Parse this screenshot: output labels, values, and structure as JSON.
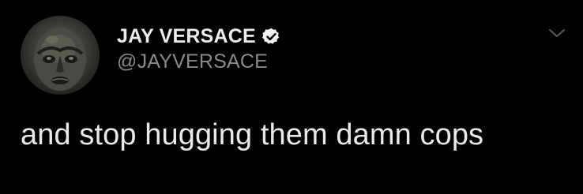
{
  "tweet": {
    "author": {
      "display_name": "JAY VERSACE",
      "handle": "@JAYVERSACE",
      "verified": true,
      "avatar_icon": "mask-face-avatar",
      "verified_icon": "verified-badge-icon"
    },
    "text": "and stop hugging them damn cops",
    "menu_icon": "chevron-down-icon"
  },
  "colors": {
    "background": "#000000",
    "display_name": "#ececec",
    "handle": "#8a8a8a",
    "text": "#e9e9e9",
    "verified_badge": "#f2f2f2",
    "chevron": "#5a5a5a"
  }
}
